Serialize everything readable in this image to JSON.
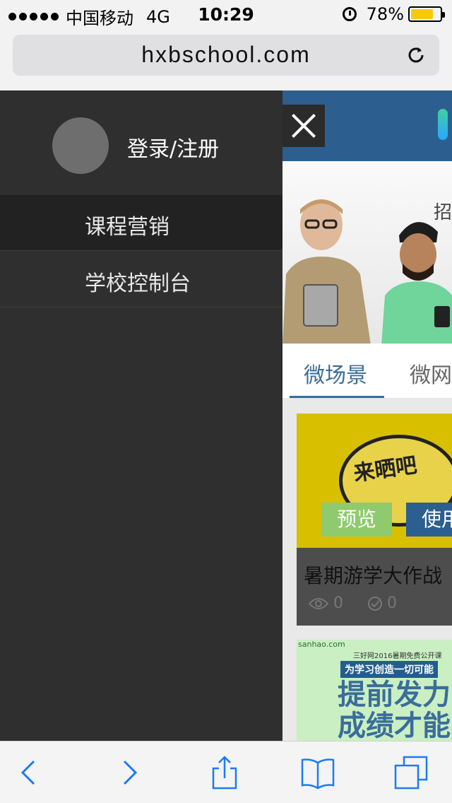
{
  "status_bar": {
    "carrier": "中国移动",
    "network": "4G",
    "time": "10:29",
    "battery": "78%",
    "battery_level": 0.78,
    "battery_color": "#f6c90e"
  },
  "browser": {
    "url": "hxbschool.com"
  },
  "drawer": {
    "login_label": "登录/注册",
    "menu": [
      {
        "label": "课程营销",
        "active": true
      },
      {
        "label": "学校控制台",
        "active": false
      }
    ]
  },
  "page": {
    "banner_char": "招",
    "tabs": [
      {
        "label": "微场景",
        "active": true
      },
      {
        "label": "微网"
      }
    ],
    "card1": {
      "thumb_text": "来晒吧",
      "preview_label": "预览",
      "use_label": "使用",
      "title": "暑期游学大作战",
      "views": "0",
      "uses": "0"
    },
    "card2": {
      "brand": "sanhao.com",
      "sub": "三好网2016暑期免费公开课",
      "slogan": "为学习创造一切可能",
      "line1": "提前发力",
      "line2": "成绩才能"
    }
  },
  "icons": {
    "close": "close-icon",
    "reload": "reload-icon",
    "back": "back-icon",
    "forward": "forward-icon",
    "share": "share-icon",
    "bookmarks": "bookmarks-icon",
    "tabs": "tabs-icon"
  },
  "colors": {
    "drawer_bg": "#2f2f2f",
    "accent": "#2c5f8f",
    "ios_blue": "#1a7cf5",
    "preview_green": "#8fca6e"
  }
}
